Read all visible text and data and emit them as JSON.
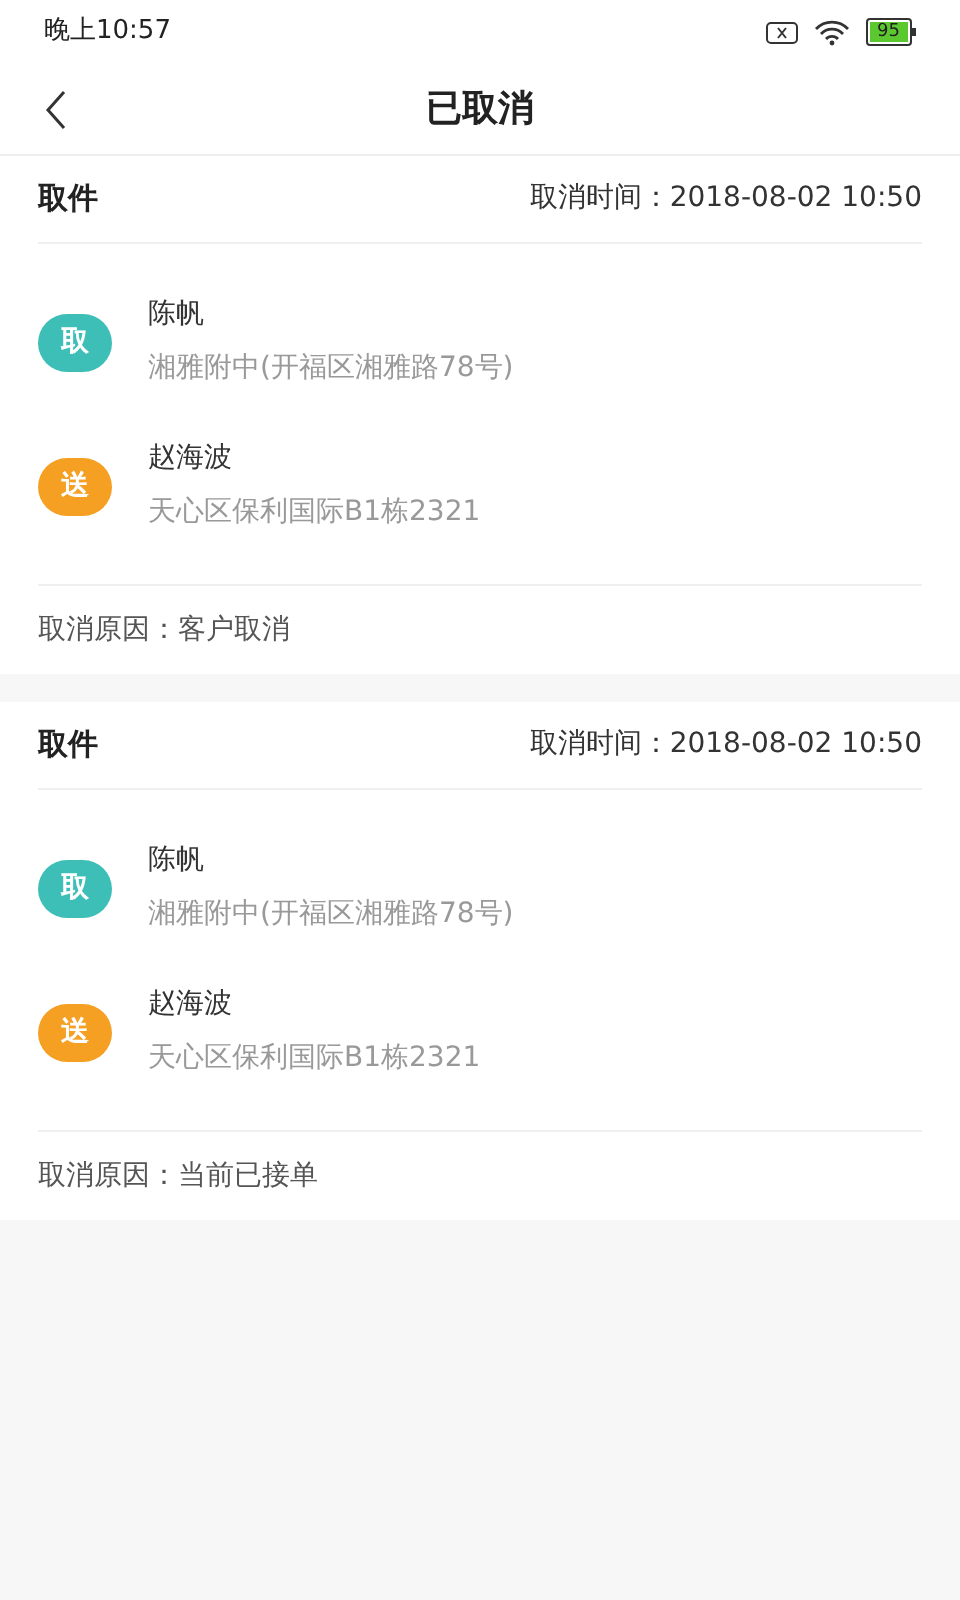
{
  "status_bar": {
    "time": "晚上10:57",
    "battery": "95"
  },
  "nav": {
    "title": "已取消"
  },
  "orders": [
    {
      "type": "取件",
      "cancel_time": "取消时间：2018-08-02 10:50",
      "stops": [
        {
          "badge": "取",
          "color": "#3dbfb8",
          "name": "陈帆",
          "address": "湘雅附中(开福区湘雅路78号)"
        },
        {
          "badge": "送",
          "color": "#f5a023",
          "name": "赵海波",
          "address": "天心区保利国际B1栋2321"
        }
      ],
      "reason": "取消原因：客户取消"
    },
    {
      "type": "取件",
      "cancel_time": "取消时间：2018-08-02 10:50",
      "stops": [
        {
          "badge": "取",
          "color": "#3dbfb8",
          "name": "陈帆",
          "address": "湘雅附中(开福区湘雅路78号)"
        },
        {
          "badge": "送",
          "color": "#f5a023",
          "name": "赵海波",
          "address": "天心区保利国际B1栋2321"
        }
      ],
      "reason": "取消原因：当前已接单"
    }
  ]
}
